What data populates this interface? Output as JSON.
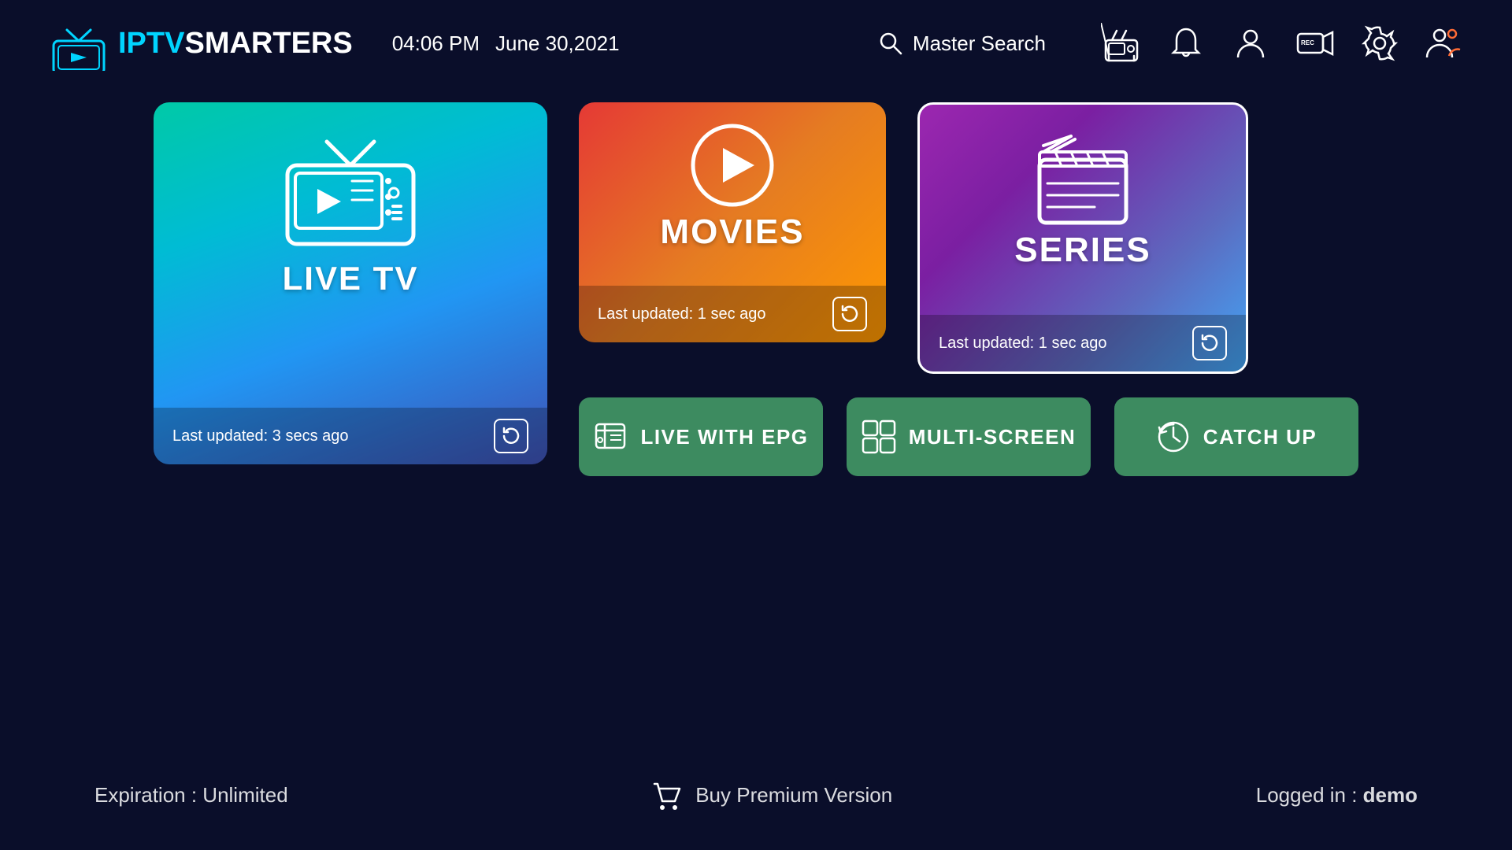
{
  "header": {
    "logo_iptv": "IPTV",
    "logo_smarters": "SMARTERS",
    "time": "04:06 PM",
    "date": "June 30,2021",
    "search_placeholder": "Master Search",
    "icons": [
      {
        "name": "radio-icon",
        "symbol": "📻"
      },
      {
        "name": "notification-icon",
        "symbol": "🔔"
      },
      {
        "name": "profile-icon",
        "symbol": "👤"
      },
      {
        "name": "record-icon",
        "symbol": "📹"
      },
      {
        "name": "settings-icon",
        "symbol": "⚙️"
      },
      {
        "name": "users-icon",
        "symbol": "👥"
      }
    ]
  },
  "cards": {
    "live_tv": {
      "title": "LIVE TV",
      "last_updated": "Last updated: 3 secs ago"
    },
    "movies": {
      "title": "MOVIES",
      "last_updated": "Last updated: 1 sec ago"
    },
    "series": {
      "title": "SERIES",
      "last_updated": "Last updated: 1 sec ago"
    }
  },
  "buttons": {
    "epg": "LIVE WITH EPG",
    "multiscreen": "MULTI-SCREEN",
    "catchup": "CATCH UP"
  },
  "footer": {
    "expiration_label": "Expiration : Unlimited",
    "buy_premium": "Buy Premium Version",
    "logged_in_label": "Logged in : ",
    "logged_in_user": "demo"
  }
}
